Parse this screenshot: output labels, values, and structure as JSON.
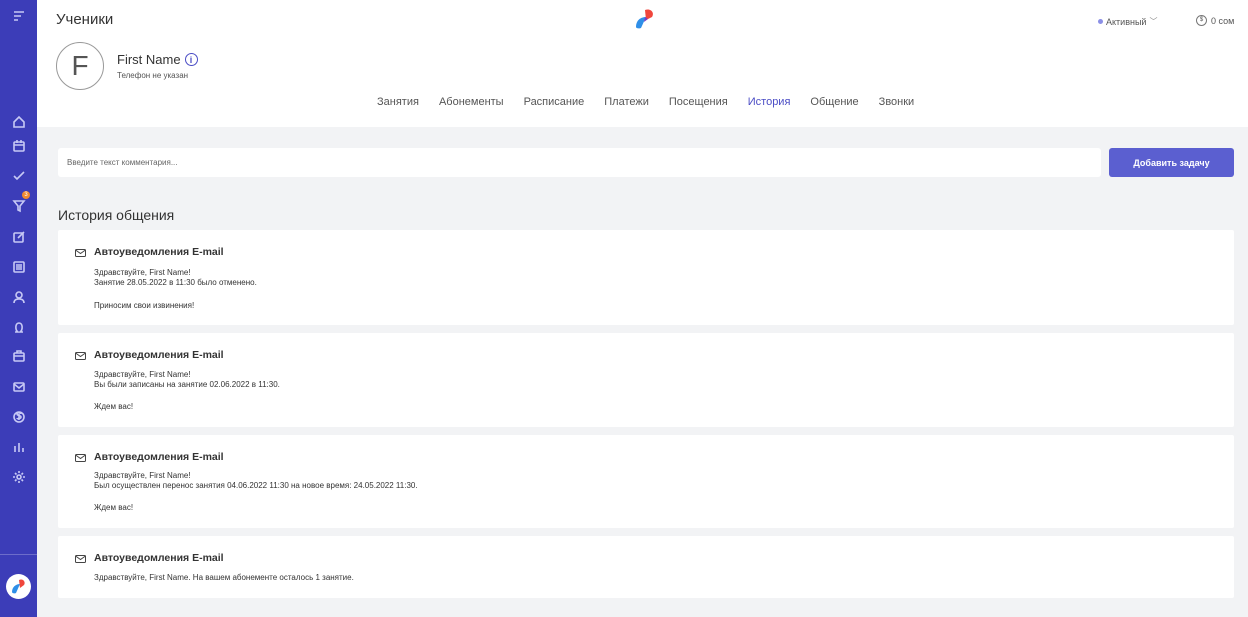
{
  "header": {
    "title": "Ученики",
    "status": "Активный",
    "balance": "0 сом",
    "avatar_letter": "F",
    "client_name": "First Name",
    "client_phone": "Телефон не указан"
  },
  "tabs": [
    {
      "label": "Занятия"
    },
    {
      "label": "Абонементы"
    },
    {
      "label": "Расписание"
    },
    {
      "label": "Платежи"
    },
    {
      "label": "Посещения"
    },
    {
      "label": "История",
      "active": true
    },
    {
      "label": "Общение"
    },
    {
      "label": "Звонки"
    }
  ],
  "comment": {
    "placeholder": "Введите текст комментария...",
    "button": "Добавить задачу"
  },
  "history": {
    "title": "История общения",
    "cards": [
      {
        "title": "Автоуведомления E-mail",
        "lines": [
          "Здравствуйте, First Name!",
          "Занятие 28.05.2022 в 11:30 было отменено.",
          "",
          "Приносим свои извинения!"
        ]
      },
      {
        "title": "Автоуведомления E-mail",
        "lines": [
          "Здравствуйте, First Name!",
          "Вы были записаны на занятие 02.06.2022 в 11:30.",
          "",
          "Ждем вас!"
        ]
      },
      {
        "title": "Автоуведомления E-mail",
        "lines": [
          "Здравствуйте, First Name!",
          "Был осуществлен перенос занятия 04.06.2022 11:30 на новое время: 24.05.2022 11:30.",
          "",
          "Ждем вас!"
        ]
      },
      {
        "title": "Автоуведомления E-mail",
        "lines": [
          "Здравствуйте, First Name. На вашем абонементе осталось 1 занятие."
        ]
      }
    ]
  },
  "sidebar": {
    "badge": "3",
    "icons": [
      "menu-icon",
      "home-icon",
      "calendar-icon",
      "check-icon",
      "filter-icon",
      "edit-icon",
      "list-icon",
      "user-icon",
      "omega-icon",
      "briefcase-icon",
      "mail-icon",
      "money-icon",
      "chart-icon",
      "gear-icon"
    ]
  },
  "colors": {
    "accent": "#4b4dc5",
    "sidebar": "#3c3db8",
    "button": "#5b5fd0"
  }
}
